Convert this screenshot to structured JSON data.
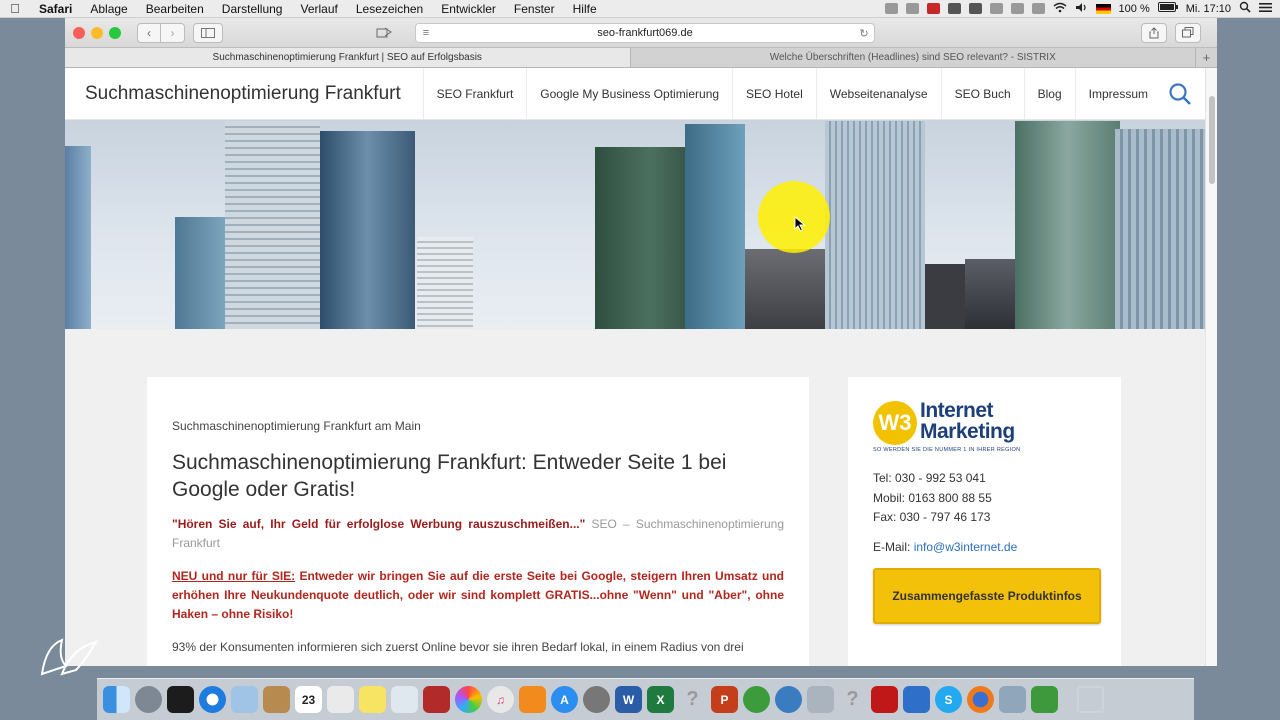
{
  "menubar": {
    "app": "Safari",
    "items": [
      "Ablage",
      "Bearbeiten",
      "Darstellung",
      "Verlauf",
      "Lesezeichen",
      "Entwickler",
      "Fenster",
      "Hilfe"
    ],
    "battery": "100 %",
    "clock": "Mi. 17:10"
  },
  "browser": {
    "url": "seo-frankfurt069.de",
    "tabs": [
      {
        "label": "Suchmaschinenoptimierung Frankfurt | SEO auf Erfolgsbasis",
        "active": true
      },
      {
        "label": "Welche Überschriften (Headlines) sind SEO relevant? - SISTRIX",
        "active": false
      }
    ]
  },
  "site": {
    "title": "Suchmaschinenoptimierung Frankfurt",
    "nav": [
      "SEO Frankfurt",
      "Google My Business Optimierung",
      "SEO Hotel",
      "Webseitenanalyse",
      "SEO Buch",
      "Blog",
      "Impressum"
    ]
  },
  "article": {
    "kicker": "Suchmaschinenoptimierung Frankfurt am Main",
    "title": "Suchmaschinenoptimierung Frankfurt: Entweder Seite 1 bei Google oder Gratis!",
    "quote": "\"Hören Sie auf, Ihr Geld für erfolglose Werbung rauszuschmeißen...\"",
    "quote_source": "SEO – Suchmaschinenoptimierung Frankfurt",
    "promo_label": "NEU und nur für SIE:",
    "promo_text": "Entweder wir bringen Sie auf die erste Seite bei Google, steigern Ihren Umsatz und erhöhen Ihre Neukundenquote deutlich, oder wir sind komplett GRATIS...ohne \"Wenn\" und \"Aber\", ohne Haken – ohne Risiko!",
    "body": "93% der Konsumenten informieren sich zuerst Online bevor sie ihren Bedarf lokal, in einem Radius von drei"
  },
  "sidebar": {
    "logo_mark": "W3",
    "logo_line1": "Internet",
    "logo_line2": "Marketing",
    "logo_tagline": "SO WERDEN SIE DIE NUMMER 1 IN IHRER REGION",
    "tel": "Tel: 030 - 992 53 041",
    "mobil": "Mobil: 0163 800 88 55",
    "fax": "Fax: 030 - 797 46 173",
    "email_label": "E-Mail:",
    "email": "info@w3internet.de",
    "cta": "Zusammengefasste Produktinfos"
  },
  "dock": {
    "calendar_day": "23",
    "apps": [
      "finder-icon",
      "launchpad-icon",
      "mission-control-icon",
      "safari-icon",
      "preview-icon",
      "notes-icon",
      "calendar-icon",
      "reminders-icon",
      "stickies-icon",
      "textedit-icon",
      "photobooth-icon",
      "photos-icon",
      "itunes-icon",
      "ibooks-icon",
      "app-store-icon",
      "system-preferences-icon",
      "word-icon",
      "excel-icon",
      "help-icon",
      "powerpoint-icon",
      "messenger-icon",
      "network-icon",
      "utility-icon",
      "help-icon-2",
      "acrobat-icon",
      "teamviewer-icon",
      "skype-icon",
      "firefox-icon",
      "screenshot-icon",
      "camtasia-icon",
      "trash-icon"
    ]
  },
  "colors": {
    "promo_red": "#b3261e",
    "quote_red": "#9b1b1b",
    "cta_yellow": "#f4c10a",
    "logo_blue": "#1d3f7a",
    "link_blue": "#2a6ebb"
  }
}
